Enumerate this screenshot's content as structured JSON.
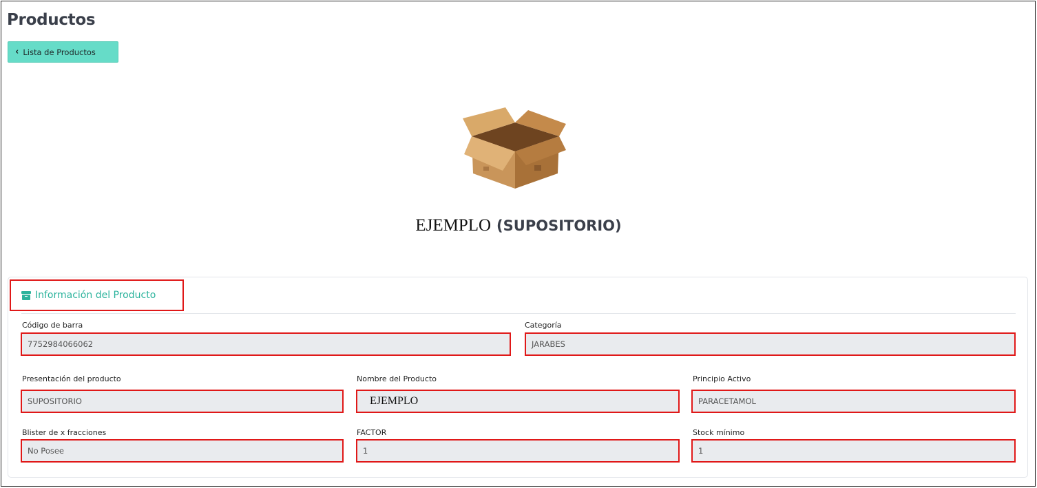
{
  "page": {
    "title": "Productos"
  },
  "toolbar": {
    "back_label": "Lista de Productos",
    "back_icon": "chevron-left-icon"
  },
  "hero": {
    "image_icon": "cardboard-box-icon",
    "product_name": "EJEMPLO",
    "presentation": "(SUPOSITORIO)"
  },
  "section": {
    "title": "Información del Producto",
    "icon": "archive-icon",
    "accent": "#2bb39c"
  },
  "fields": {
    "barcode": {
      "label": "Código de barra",
      "value": "7752984066062"
    },
    "category": {
      "label": "Categoría",
      "value": "JARABES"
    },
    "presentation": {
      "label": "Presentación del producto",
      "value": "SUPOSITORIO"
    },
    "name": {
      "label": "Nombre del Producto",
      "value": "EJEMPLO"
    },
    "active": {
      "label": "Principio Activo",
      "value": "PARACETAMOL"
    },
    "blister": {
      "label": "Blister de x fracciones",
      "value": "No Posee"
    },
    "factor": {
      "label": "FACTOR",
      "value": "1"
    },
    "stock": {
      "label": "Stock mínimo",
      "value": "1"
    }
  },
  "colors": {
    "button_bg": "#66dcc8",
    "highlight_border": "#e01818",
    "field_bg": "#e9ebee"
  }
}
